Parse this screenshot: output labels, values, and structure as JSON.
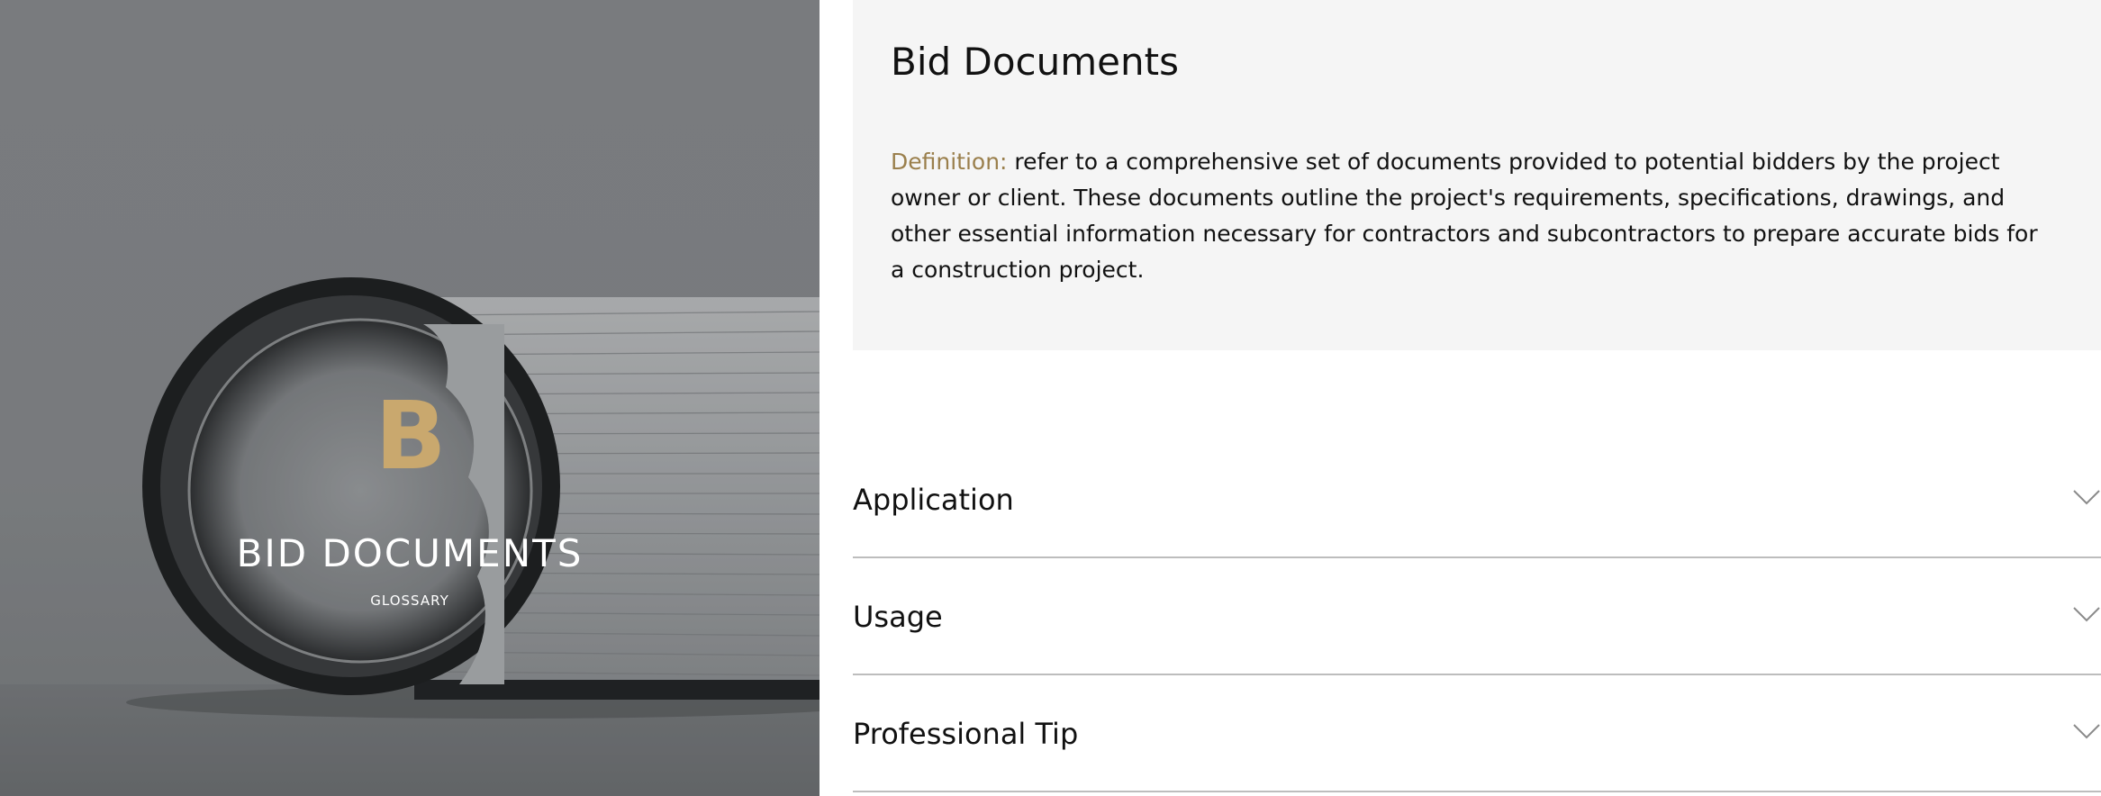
{
  "hero": {
    "letter": "B",
    "title": "BID DOCUMENTS",
    "subtitle": "GLOSSARY"
  },
  "definition": {
    "title": "Bid Documents",
    "label": "Definition:",
    "text": " refer to a comprehensive set of documents provided to potential bidders by the project owner or client. These documents outline the project's requirements, specifications, drawings, and other essential information necessary for contractors and subcontractors to prepare accurate bids for a construction project."
  },
  "accordion": {
    "items": [
      {
        "label": "Application",
        "icon": "chevron-down-icon"
      },
      {
        "label": "Usage",
        "icon": "chevron-down-icon"
      },
      {
        "label": "Professional Tip",
        "icon": "chevron-down-icon"
      }
    ]
  },
  "colors": {
    "accent_gold": "#c9a86e",
    "definition_label": "#9a7f4c",
    "card_background": "#f5f5f5",
    "divider": "#bdbdbd"
  }
}
